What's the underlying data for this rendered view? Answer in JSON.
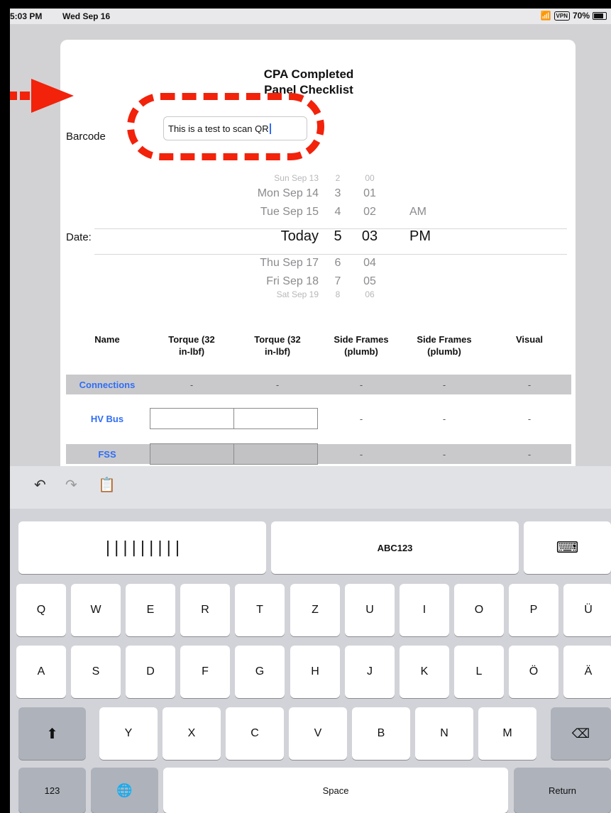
{
  "status_bar": {
    "time": "5:03 PM",
    "date": "Wed Sep 16",
    "vpn": "VPN",
    "battery": "70%"
  },
  "form": {
    "title_line1": "CPA Completed",
    "title_line2": "Panel Checklist",
    "barcode_label": "Barcode",
    "barcode_value": "This is a test to scan QR",
    "date_label": "Date:",
    "picker": {
      "rows": [
        {
          "day": "Sun Sep 13",
          "hour": "2",
          "minute": "00",
          "ampm": ""
        },
        {
          "day": "Mon Sep 14",
          "hour": "3",
          "minute": "01",
          "ampm": ""
        },
        {
          "day": "Tue Sep 15",
          "hour": "4",
          "minute": "02",
          "ampm": "AM"
        },
        {
          "day": "Today",
          "hour": "5",
          "minute": "03",
          "ampm": "PM"
        },
        {
          "day": "Thu Sep 17",
          "hour": "6",
          "minute": "04",
          "ampm": ""
        },
        {
          "day": "Fri Sep 18",
          "hour": "7",
          "minute": "05",
          "ampm": ""
        },
        {
          "day": "Sat Sep 19",
          "hour": "8",
          "minute": "06",
          "ampm": ""
        }
      ]
    }
  },
  "table": {
    "headers": [
      "Name",
      "Torque (32\nin-lbf)",
      "Torque (32\nin-lbf)",
      "Side Frames\n(plumb)",
      "Side Frames\n(plumb)",
      "Visual"
    ],
    "rows": [
      {
        "name": "Connections",
        "values": [
          "-",
          "-",
          "-",
          "-",
          "-"
        ]
      },
      {
        "name": "HV Bus",
        "values": [
          "",
          "",
          "-",
          "-",
          "-"
        ]
      },
      {
        "name": "FSS",
        "values": [
          "",
          "",
          "-",
          "-",
          "-"
        ]
      }
    ]
  },
  "keyboard": {
    "toolbar": [
      "undo-icon",
      "redo-icon",
      "paste-icon"
    ],
    "scan_barcode_icon": "barcode-icon",
    "scan_text_label": "ABC123",
    "dismiss_icon": "keyboard-dismiss-icon",
    "row1": [
      "Q",
      "W",
      "E",
      "R",
      "T",
      "Z",
      "U",
      "I",
      "O",
      "P",
      "Ü"
    ],
    "row2": [
      "A",
      "S",
      "D",
      "F",
      "G",
      "H",
      "J",
      "K",
      "L",
      "Ö",
      "Ä"
    ],
    "row3": [
      "Y",
      "X",
      "C",
      "V",
      "B",
      "N",
      "M"
    ],
    "numbers_key": "123",
    "space_key": "Space",
    "return_key": "Return"
  },
  "annotation_color": "#f2220b",
  "accent_color": "#2f6df6"
}
